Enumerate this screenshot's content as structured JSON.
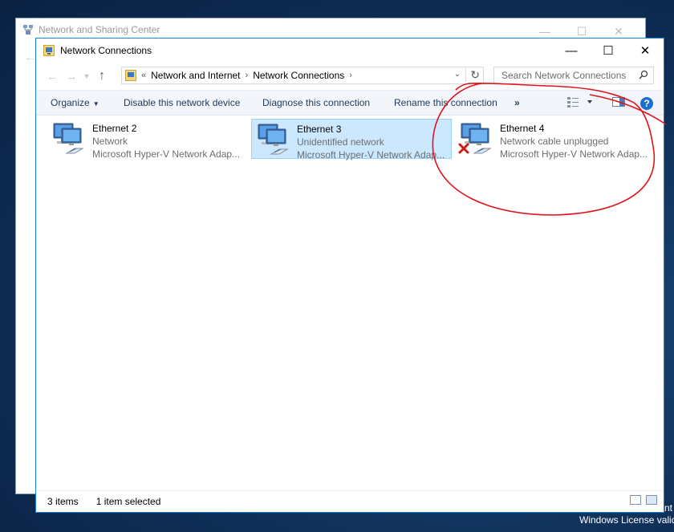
{
  "background_window": {
    "title": "Network and Sharing Center"
  },
  "window": {
    "title": "Network Connections",
    "controls": [
      "minimize",
      "maximize",
      "close"
    ]
  },
  "address_bar": {
    "prefix": "«",
    "breadcrumbs": [
      "Network and Internet",
      "Network Connections"
    ],
    "search_placeholder": "Search Network Connections"
  },
  "toolbar": {
    "organize": "Organize",
    "disable": "Disable this network device",
    "diagnose": "Diagnose this connection",
    "rename": "Rename this connection",
    "more": "»"
  },
  "connections": [
    {
      "name": "Ethernet 2",
      "status": "Network",
      "adapter": "Microsoft Hyper-V Network Adap...",
      "selected": false,
      "disconnected": false
    },
    {
      "name": "Ethernet 3",
      "status": "Unidentified network",
      "adapter": "Microsoft Hyper-V Network Adap...",
      "selected": true,
      "disconnected": false
    },
    {
      "name": "Ethernet 4",
      "status": "Network cable unplugged",
      "adapter": "Microsoft Hyper-V Network Adap...",
      "selected": false,
      "disconnected": true
    }
  ],
  "statusbar": {
    "items_count": "3 items",
    "selection": "1 item selected"
  },
  "desktop": {
    "watermark_line1": "Windows License valid",
    "watermark_fragment": "nt"
  },
  "colors": {
    "accent": "#1883d7",
    "selection_bg": "#cce8ff",
    "annotation": "#e0141e"
  }
}
